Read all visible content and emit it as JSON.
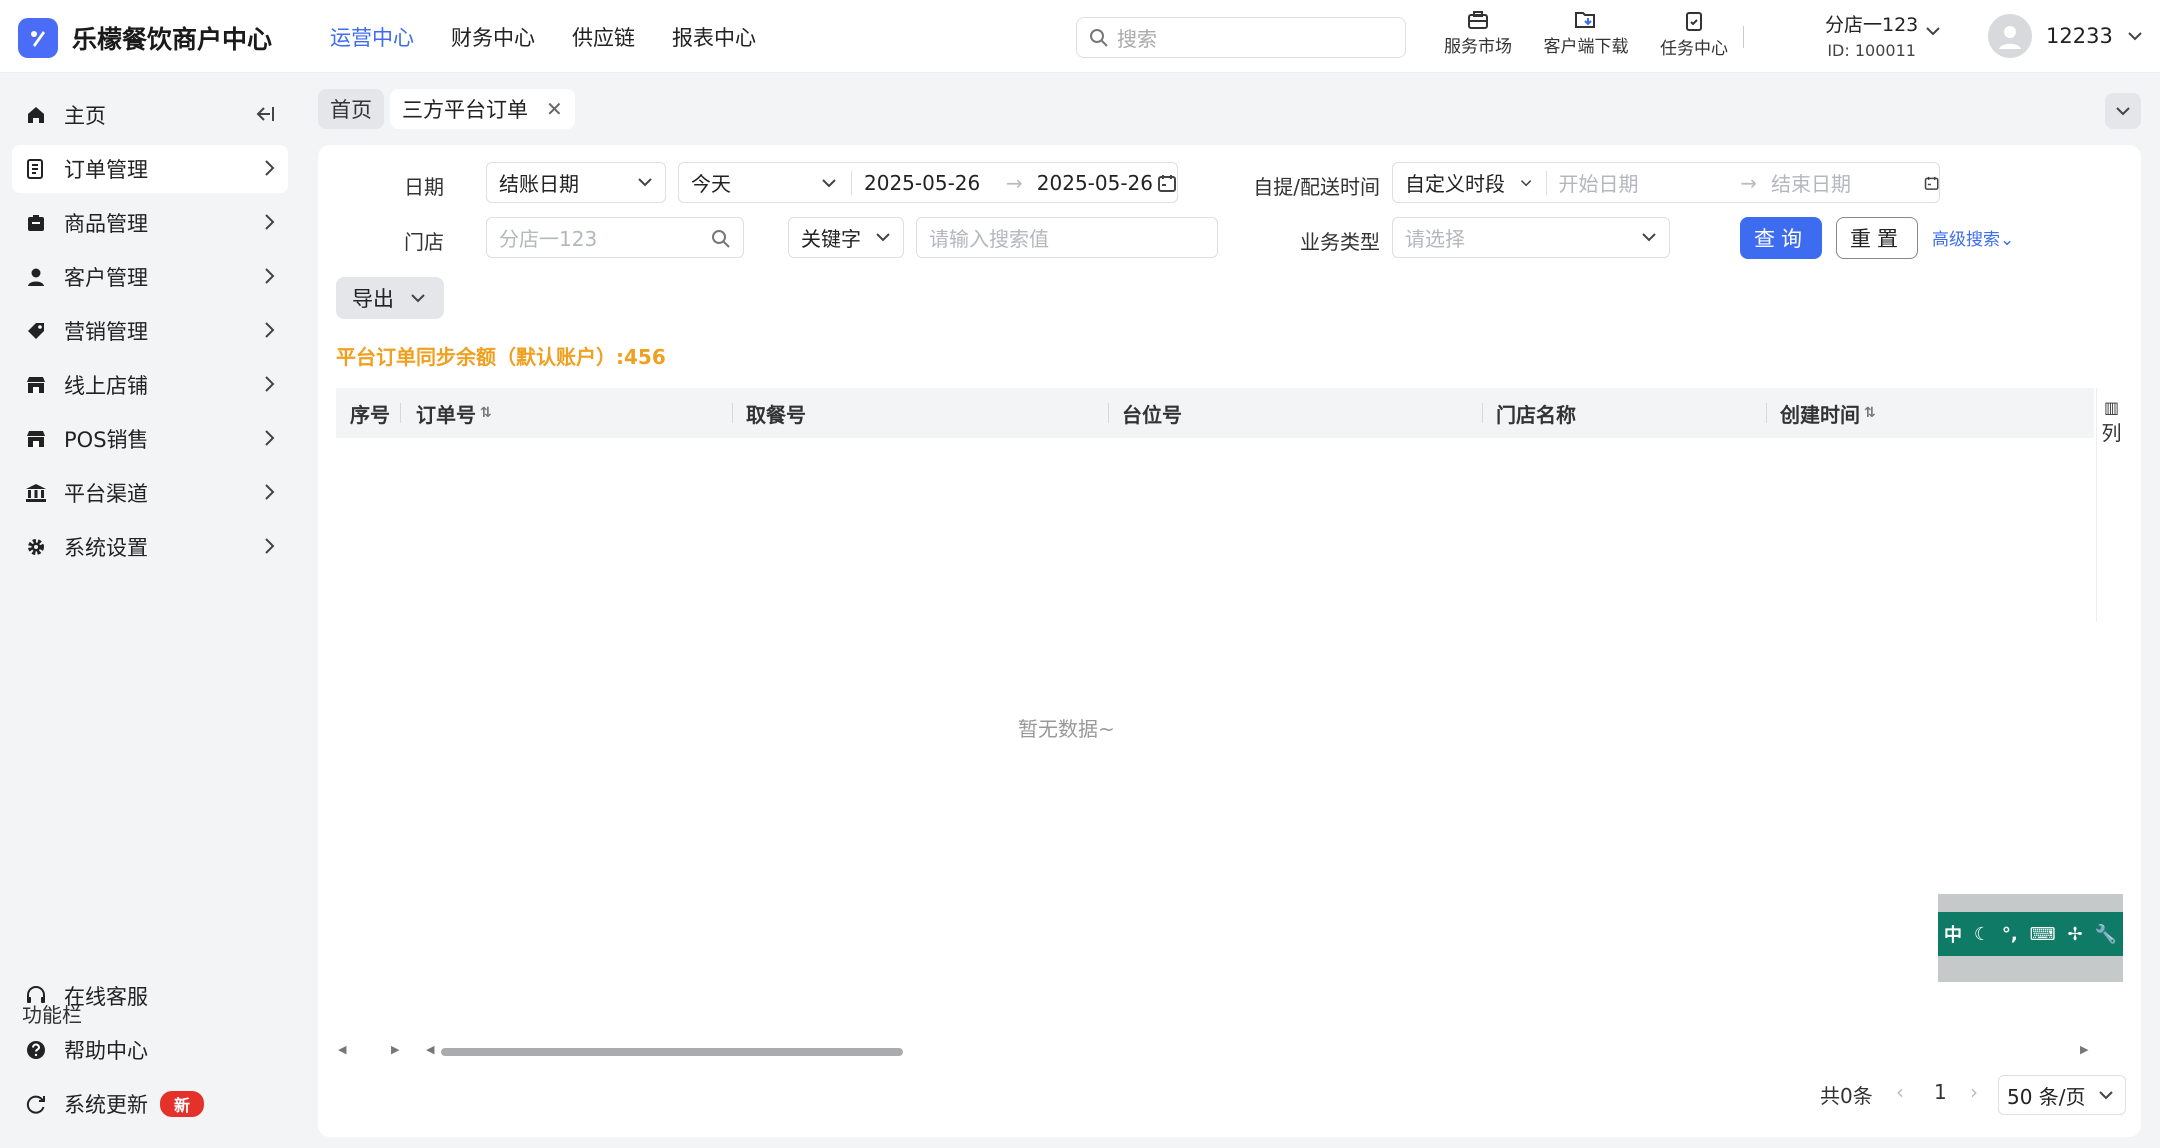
{
  "brand": {
    "name": "乐檬餐饮商户中心"
  },
  "topnav": [
    "运营中心",
    "财务中心",
    "供应链",
    "报表中心"
  ],
  "search": {
    "placeholder": "搜索"
  },
  "tools": [
    "服务市场",
    "客户端下载",
    "任务中心"
  ],
  "store": {
    "name": "分店一123",
    "id": "ID: 100011"
  },
  "user": {
    "name": "12233"
  },
  "sidebar": {
    "items": [
      "主页",
      "订单管理",
      "商品管理",
      "客户管理",
      "营销管理",
      "线上店铺",
      "POS销售",
      "平台渠道",
      "系统设置"
    ],
    "function_title": "功能栏",
    "functions": [
      "在线客服",
      "帮助中心",
      "系统更新"
    ],
    "new_badge": "新"
  },
  "tabs": {
    "home": "首页",
    "current": "三方平台订单"
  },
  "filters": {
    "date_label": "日期",
    "date_type": "结账日期",
    "date_range": "今天",
    "start_date": "2025-05-26",
    "end_date": "2025-05-26",
    "pickup_label": "自提/配送时间",
    "pickup_type": "自定义时段",
    "pickup_start_ph": "开始日期",
    "pickup_end_ph": "结束日期",
    "store_label": "门店",
    "store_ph": "分店一123",
    "keyword": "关键字",
    "keyword_ph": "请输入搜索值",
    "biz_label": "业务类型",
    "biz_ph": "请选择",
    "query": "查询",
    "reset": "重置",
    "advanced": "高级搜索"
  },
  "export": "导出",
  "balance": "平台订单同步余额（默认账户）:456",
  "table": {
    "headers": [
      "序号",
      "订单号",
      "取餐号",
      "台位号",
      "门店名称",
      "创建时间"
    ],
    "columns_btn": "列",
    "empty": "暂无数据~"
  },
  "ime": {
    "keys": [
      "中",
      "☾",
      "°,",
      "⌨",
      "✢",
      "🔧"
    ]
  },
  "pager": {
    "total": "共0条",
    "page": "1",
    "size": "50 条/页"
  }
}
